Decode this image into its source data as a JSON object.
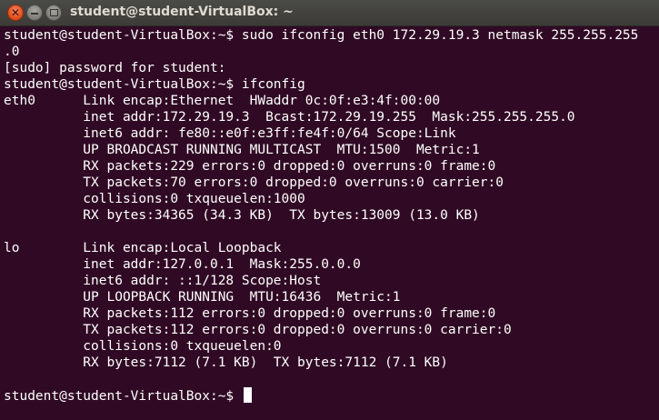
{
  "window": {
    "title": "student@student-VirtualBox: ~",
    "close_glyph": "✕",
    "background_color": "#300a24",
    "text_color": "#ffffff"
  },
  "terminal": {
    "lines": [
      "student@student-VirtualBox:~$ sudo ifconfig eth0 172.29.19.3 netmask 255.255.255",
      ".0",
      "[sudo] password for student:",
      "student@student-VirtualBox:~$ ifconfig",
      "eth0      Link encap:Ethernet  HWaddr 0c:0f:e3:4f:00:00",
      "          inet addr:172.29.19.3  Bcast:172.29.19.255  Mask:255.255.255.0",
      "          inet6 addr: fe80::e0f:e3ff:fe4f:0/64 Scope:Link",
      "          UP BROADCAST RUNNING MULTICAST  MTU:1500  Metric:1",
      "          RX packets:229 errors:0 dropped:0 overruns:0 frame:0",
      "          TX packets:70 errors:0 dropped:0 overruns:0 carrier:0",
      "          collisions:0 txqueuelen:1000",
      "          RX bytes:34365 (34.3 KB)  TX bytes:13009 (13.0 KB)",
      "",
      "lo        Link encap:Local Loopback",
      "          inet addr:127.0.0.1  Mask:255.0.0.0",
      "          inet6 addr: ::1/128 Scope:Host",
      "          UP LOOPBACK RUNNING  MTU:16436  Metric:1",
      "          RX packets:112 errors:0 dropped:0 overruns:0 frame:0",
      "          TX packets:112 errors:0 dropped:0 overruns:0 carrier:0",
      "          collisions:0 txqueuelen:0",
      "          RX bytes:7112 (7.1 KB)  TX bytes:7112 (7.1 KB)",
      ""
    ],
    "prompt": "student@student-VirtualBox:~$ "
  }
}
